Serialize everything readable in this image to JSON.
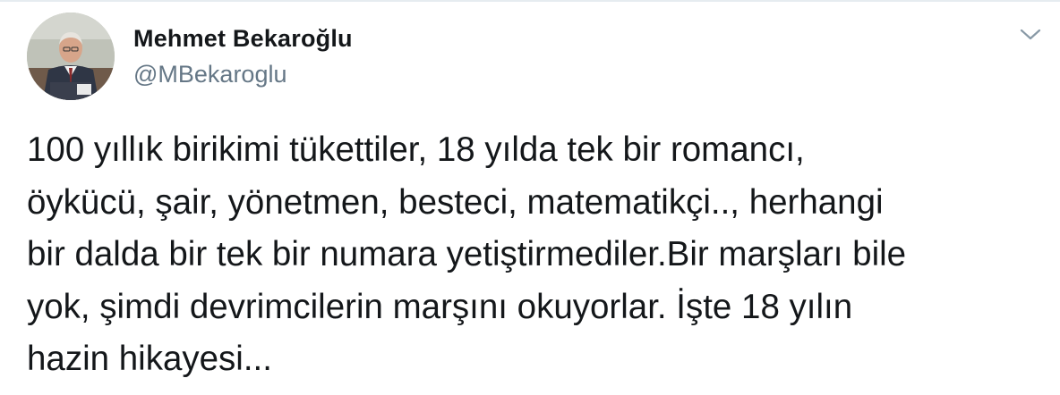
{
  "tweet": {
    "author": {
      "display_name": "Mehmet Bekaroğlu",
      "handle": "@MBekaroglu",
      "avatar_icon": "user-photo"
    },
    "caret_icon": "chevron-down-icon",
    "text_lines": [
      "100 yıllık birikimi tükettiler, 18 yılda tek bir romancı,",
      "öykücü, şair, yönetmen, besteci, matematikçi.., herhangi",
      "bir dalda bir tek bir numara yetiştirmediler.Bir marşları bile",
      "yok, şimdi devrimcilerin marşını okuyorlar. İşte 18 yılın",
      "hazin hikayesi..."
    ]
  },
  "colors": {
    "text": "#14171a",
    "secondary": "#657786",
    "border": "#e6ecf0"
  }
}
